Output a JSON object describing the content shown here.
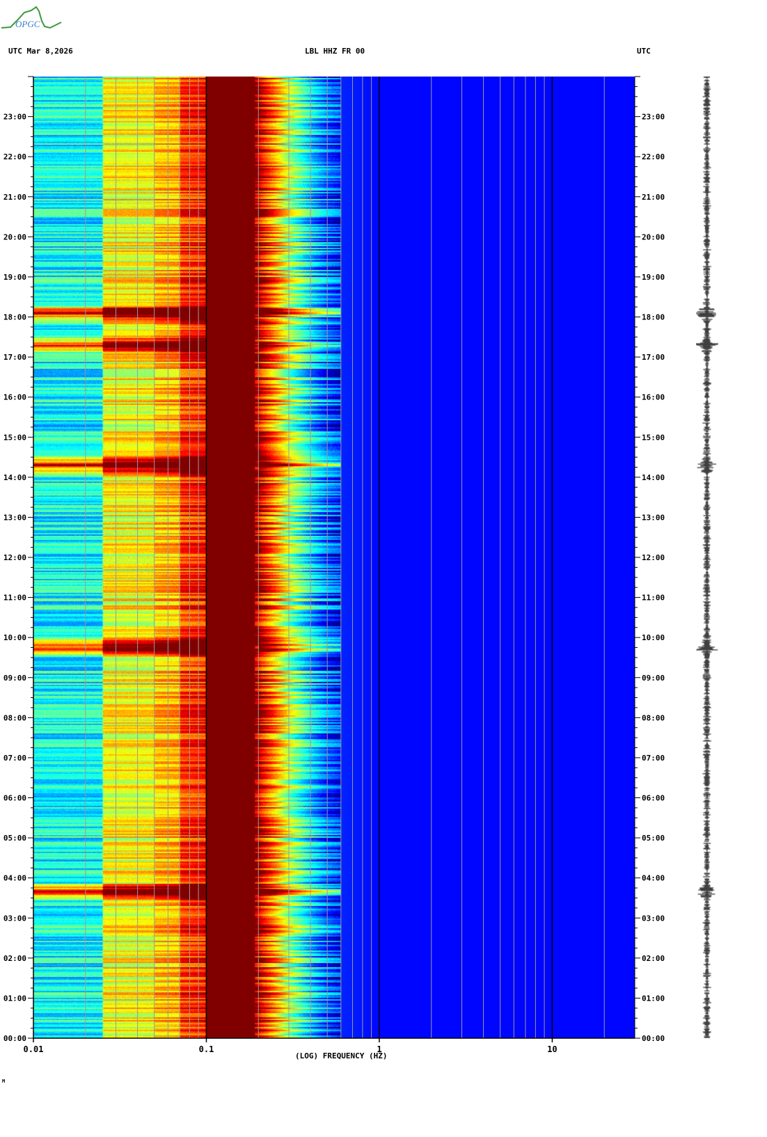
{
  "header": {
    "left": "UTC  Mar 8,2026",
    "center": "LBL HHZ FR 00",
    "right": "UTC"
  },
  "logo": {
    "text": "OPGC"
  },
  "footer_mark": "M",
  "chart_data": {
    "type": "heatmap",
    "title": "LBL HHZ FR 00",
    "xlabel": "(LOG) FREQUENCY (HZ)",
    "ylabel": "UTC",
    "xscale": "log",
    "xlim": [
      0.01,
      30
    ],
    "ylim": [
      0,
      24
    ],
    "x_ticks": [
      {
        "value": 0.01,
        "label": "0.01"
      },
      {
        "value": 0.1,
        "label": "0.1"
      },
      {
        "value": 1,
        "label": "1"
      },
      {
        "value": 10,
        "label": "10"
      }
    ],
    "y_ticks": [
      "00:00",
      "01:00",
      "02:00",
      "03:00",
      "04:00",
      "05:00",
      "06:00",
      "07:00",
      "08:00",
      "09:00",
      "10:00",
      "11:00",
      "12:00",
      "13:00",
      "14:00",
      "15:00",
      "16:00",
      "17:00",
      "18:00",
      "19:00",
      "20:00",
      "21:00",
      "22:00",
      "23:00"
    ],
    "band_levels": [
      [
        0.01,
        0.38
      ],
      [
        0.025,
        0.38
      ],
      [
        0.0251,
        0.62
      ],
      [
        0.05,
        0.62
      ],
      [
        0.0501,
        0.68
      ],
      [
        0.07,
        0.7
      ],
      [
        0.0701,
        0.82
      ],
      [
        0.098,
        0.85
      ],
      [
        0.1,
        1.0
      ],
      [
        0.19,
        1.0
      ],
      [
        0.21,
        0.88
      ],
      [
        0.25,
        0.72
      ],
      [
        0.3,
        0.55
      ],
      [
        0.4,
        0.35
      ],
      [
        0.5,
        0.22
      ],
      [
        0.6,
        0.16
      ],
      [
        1,
        0.13
      ],
      [
        30,
        0.13
      ]
    ],
    "events_utc_hours": [
      3.65,
      9.75,
      14.3,
      17.3,
      18.1
    ],
    "colormap": "jet"
  }
}
